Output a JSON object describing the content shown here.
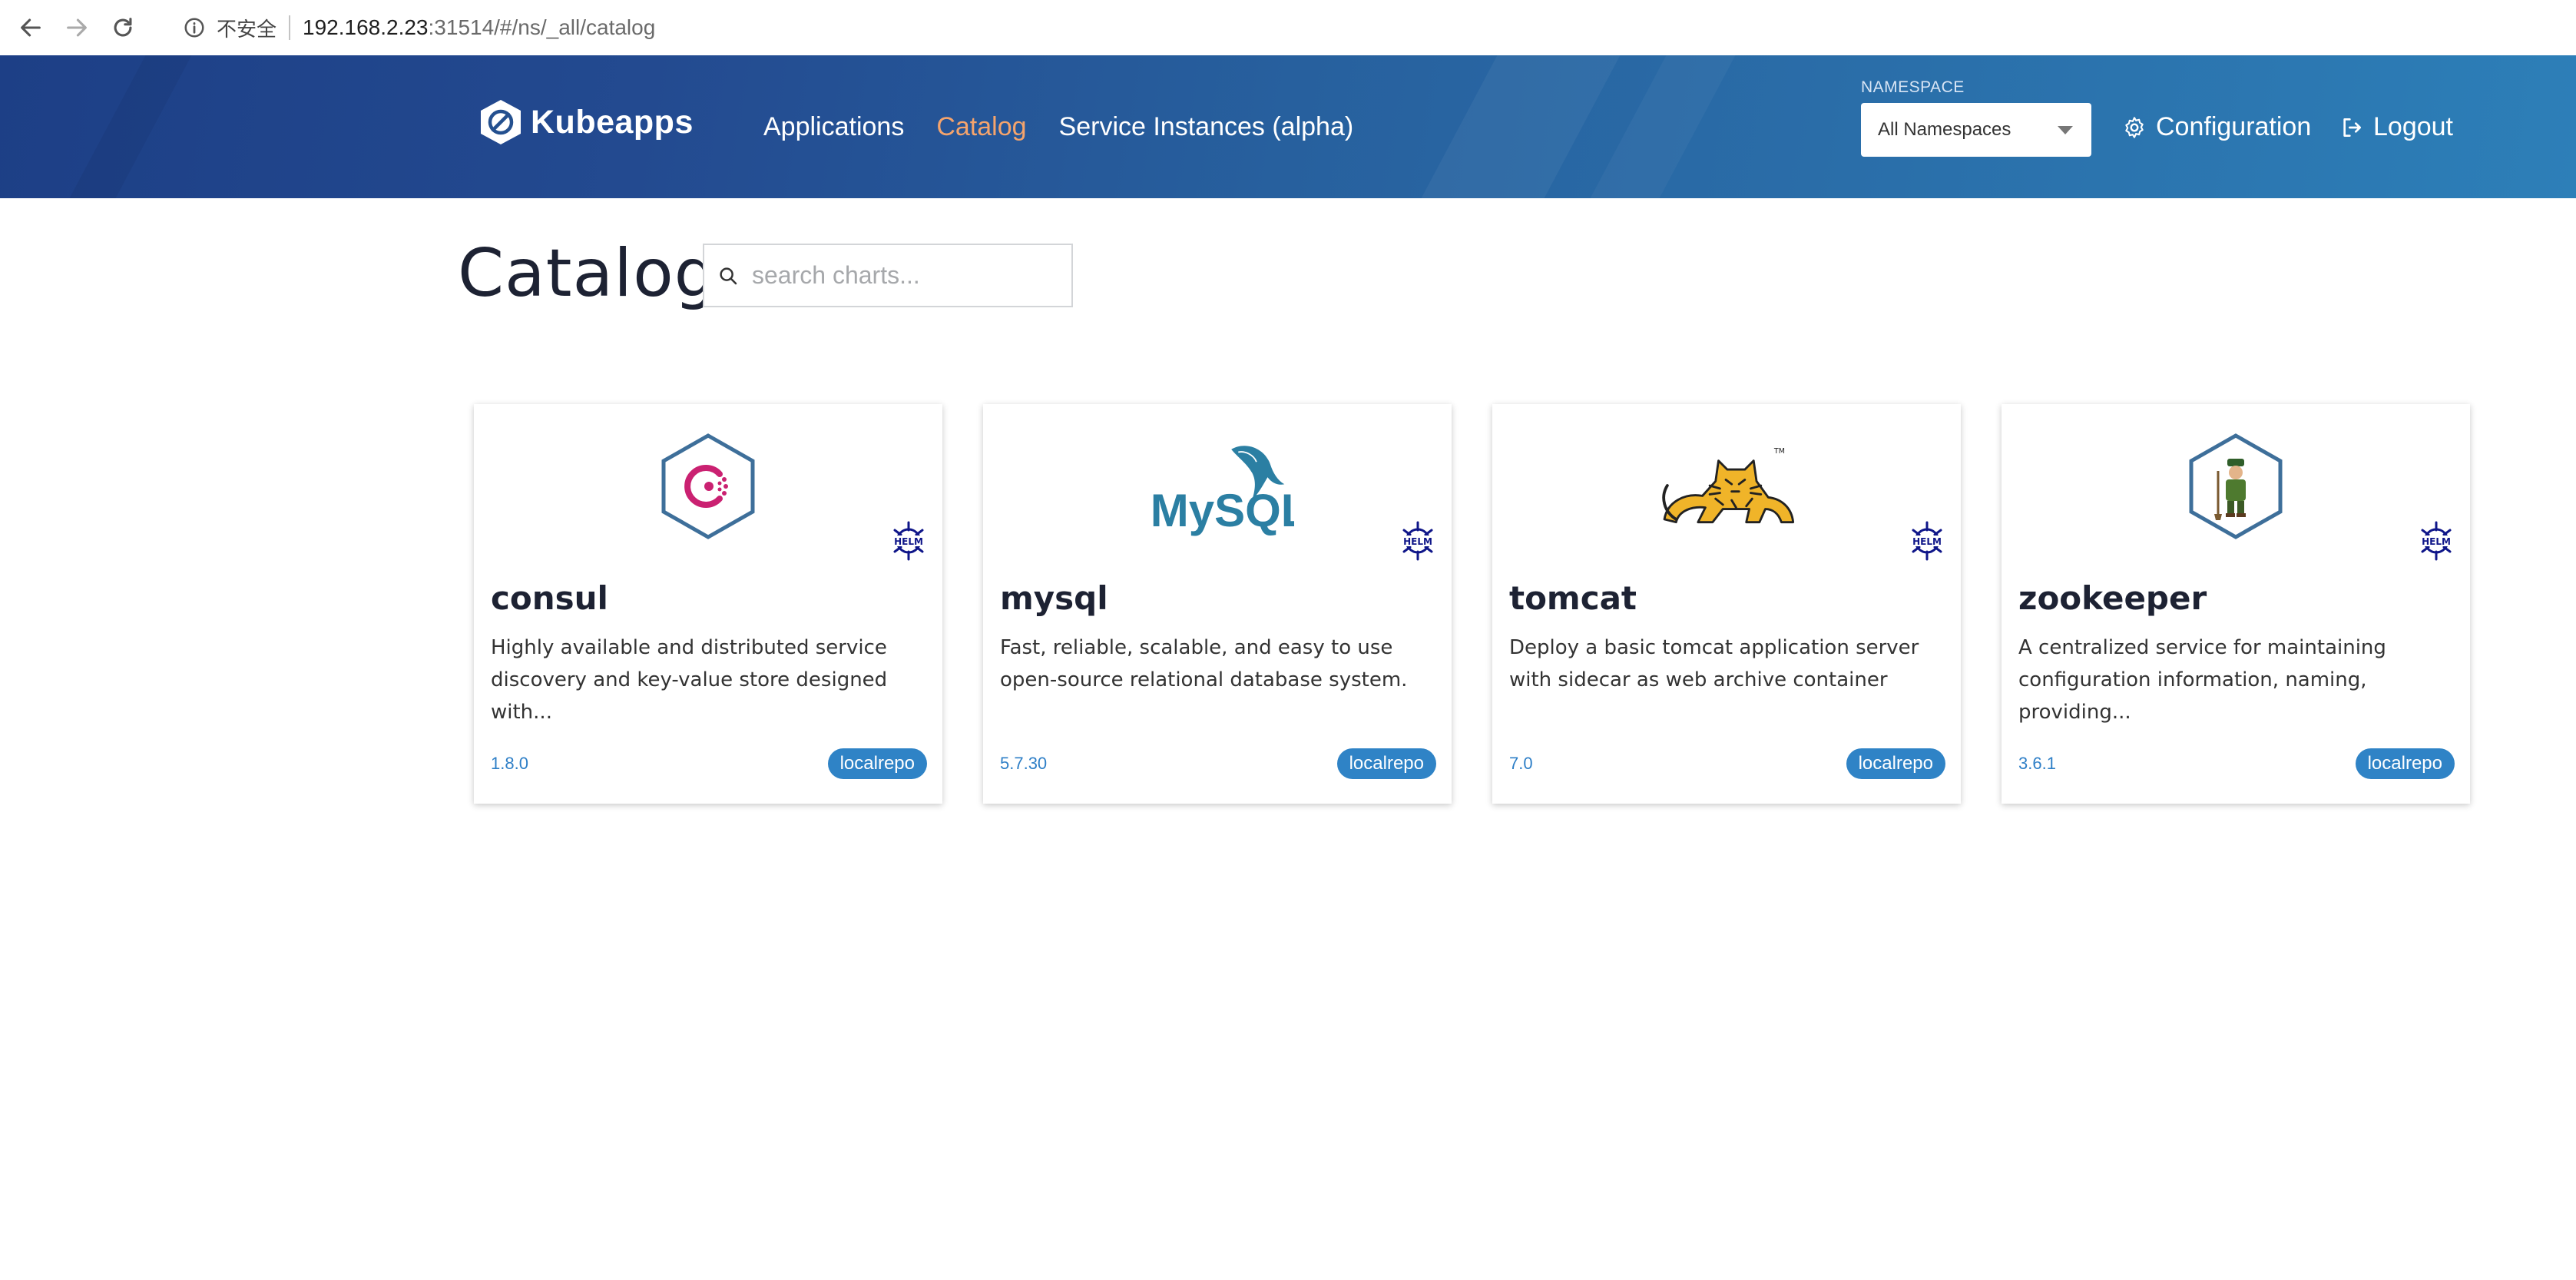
{
  "browser": {
    "insecure_label": "不安全",
    "url_host": "192.168.2.23",
    "url_path": ":31514/#/ns/_all/catalog"
  },
  "header": {
    "logo_text": "Kubeapps",
    "nav": [
      {
        "label": "Applications",
        "active": false
      },
      {
        "label": "Catalog",
        "active": true
      },
      {
        "label": "Service Instances (alpha)",
        "active": false
      }
    ],
    "namespace_label": "NAMESPACE",
    "namespace_value": "All Namespaces",
    "configuration_label": "Configuration",
    "logout_label": "Logout"
  },
  "page": {
    "title": "Catalog",
    "search_placeholder": "search charts..."
  },
  "colors": {
    "active_nav": "#f5a46c",
    "repo_badge": "#2f83c6",
    "version_text": "#2e7fc7",
    "helm_icon": "#0f1689"
  },
  "cards": [
    {
      "name": "consul",
      "description": "Highly available and distributed service discovery and key-value store designed with...",
      "version": "1.8.0",
      "repo": "localrepo",
      "icon": "consul-logo-icon"
    },
    {
      "name": "mysql",
      "description": "Fast, reliable, scalable, and easy to use open-source relational database system.",
      "version": "5.7.30",
      "repo": "localrepo",
      "icon": "mysql-logo-icon",
      "logo_text": "MySQL"
    },
    {
      "name": "tomcat",
      "description": "Deploy a basic tomcat application server with sidecar as web archive container",
      "version": "7.0",
      "repo": "localrepo",
      "icon": "tomcat-logo-icon"
    },
    {
      "name": "zookeeper",
      "description": "A centralized service for maintaining configuration information, naming, providing...",
      "version": "3.6.1",
      "repo": "localrepo",
      "icon": "zookeeper-logo-icon"
    }
  ]
}
